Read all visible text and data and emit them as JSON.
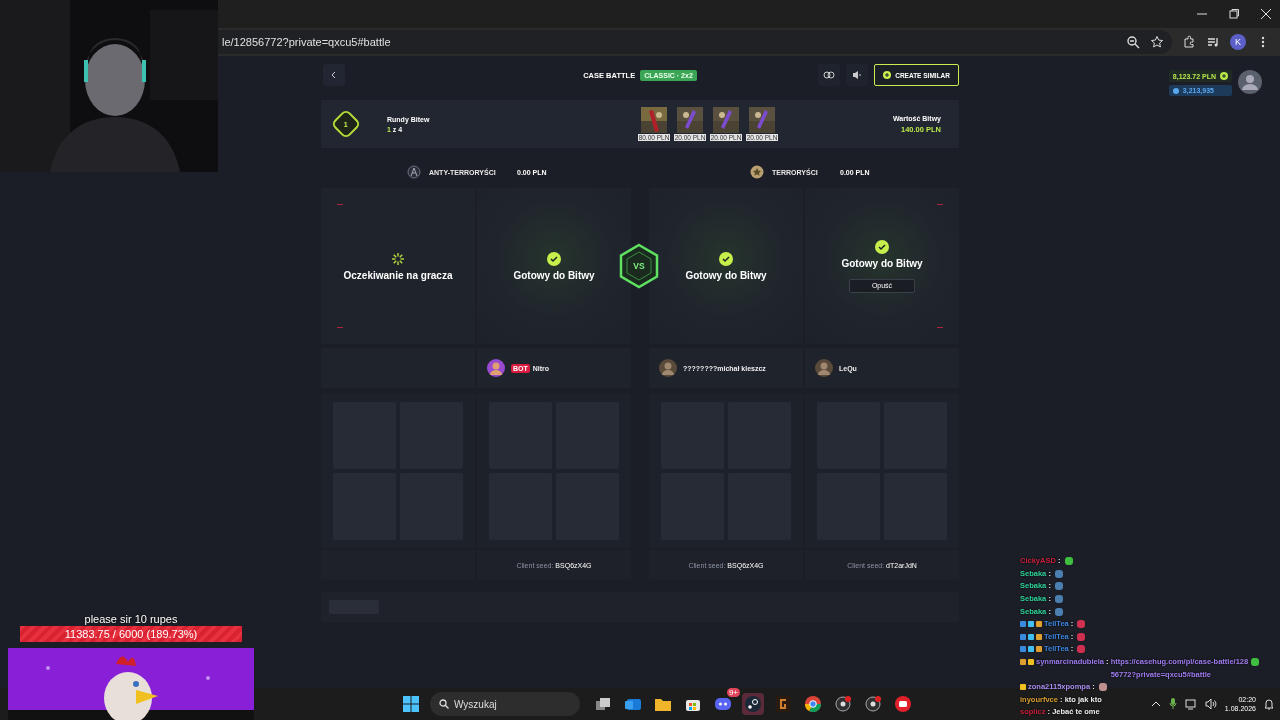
{
  "browser": {
    "url": "le/12856772?private=qxcu5#battle",
    "profile_initial": "K"
  },
  "header": {
    "title": "CASE BATTLE",
    "mode": "CLASSIC · 2x2",
    "create_button": "CREATE SIMILAR"
  },
  "balance": {
    "amount": "8,123.72 PLN",
    "points": "3,213,935"
  },
  "rounds": {
    "label": "Rundy Bitew",
    "badge": "1",
    "current": "1",
    "total": "z 4"
  },
  "cases": [
    {
      "price": "80.00 PLN",
      "kind": "gold"
    },
    {
      "price": "20.00 PLN",
      "kind": "purple"
    },
    {
      "price": "20.00 PLN",
      "kind": "purple"
    },
    {
      "price": "20.00 PLN",
      "kind": "purple"
    }
  ],
  "battle_value": {
    "label": "Wartość Bitwy",
    "amount": "140.00 PLN"
  },
  "teams": [
    {
      "name": "ANTY-TERRORYŚCI",
      "amount": "0.00 PLN",
      "kind": "ct"
    },
    {
      "name": "TERRORYŚCI",
      "amount": "0.00 PLN",
      "kind": "t"
    }
  ],
  "vs": "VS",
  "slots": [
    {
      "kind": "waiting",
      "status": "Oczekiwanie na gracza"
    },
    {
      "kind": "ready",
      "status": "Gotowy do Bitwy",
      "player": "Nitro",
      "bot_tag": "BOT",
      "seed_label": "Client seed:",
      "seed": "BSQ6zX4G"
    },
    {
      "kind": "ready",
      "status": "Gotowy do Bitwy",
      "player": "????????michał kleszcz",
      "seed_label": "Client seed:",
      "seed": "BSQ6zX4G"
    },
    {
      "kind": "ready",
      "status": "Gotowy do Bitwy",
      "player": "LeQu",
      "leave_button": "Opuść",
      "seed_label": "Client seed:",
      "seed": "dT2arJdN"
    }
  ],
  "donation": {
    "title": "please sir 10 rupes",
    "progress": "11383.75 / 6000 (189.73%)",
    "level": 1
  },
  "chat": [
    {
      "user": "CickyASD",
      "color": "#c8203c",
      "separator": ":",
      "emote": {
        "color": "#3fbf3f"
      }
    },
    {
      "user": "Sebaka",
      "color": "#2fd39a",
      "separator": ":",
      "emote": {
        "color": "#4a7fb0"
      }
    },
    {
      "user": "Sebaka",
      "color": "#2fd39a",
      "separator": ":",
      "emote": {
        "color": "#4a7fb0"
      }
    },
    {
      "user": "Sebaka",
      "color": "#2fd39a",
      "separator": ":",
      "emote": {
        "color": "#4a7fb0"
      }
    },
    {
      "user": "Sebaka",
      "color": "#2fd39a",
      "separator": ":",
      "emote": {
        "color": "#4a7fb0"
      }
    },
    {
      "user": "TellTea",
      "color": "#3d86e0",
      "separator": ":",
      "badges": [
        {
          "color": "#3a8ae0"
        },
        {
          "color": "#40c0f0"
        },
        {
          "color": "#e0a030"
        }
      ],
      "emote": {
        "color": "#d03050"
      }
    },
    {
      "user": "TellTea",
      "color": "#3d86e0",
      "separator": ":",
      "badges": [
        {
          "color": "#3a8ae0"
        },
        {
          "color": "#40c0f0"
        },
        {
          "color": "#e0a030"
        }
      ],
      "emote": {
        "color": "#d03050"
      }
    },
    {
      "user": "TellTea",
      "color": "#3d86e0",
      "separator": ":",
      "badges": [
        {
          "color": "#3a8ae0"
        },
        {
          "color": "#40c0f0"
        },
        {
          "color": "#e0a030"
        }
      ],
      "emote": {
        "color": "#d03050"
      }
    },
    {
      "user": "synmarcinadubiela",
      "color": "#9e7cf2",
      "separator": ":",
      "badges": [
        {
          "color": "#e0a030"
        },
        {
          "color": "#f0c020"
        }
      ],
      "link": "https://casehug.com/pl/case-battle/12856772?private=qxcu5#battle",
      "emote": {
        "color": "#3fbf3f"
      }
    },
    {
      "user": "zona2115xpompa",
      "color": "#a98ef0",
      "separator": ":",
      "badges": [
        {
          "color": "#f0c020"
        }
      ],
      "emote": {
        "color": "#c09090"
      }
    },
    {
      "user": "inyourfvce",
      "color": "#d9a030",
      "separator": ":",
      "text": "kto jak kto"
    },
    {
      "user": "soplicz",
      "color": "#c8203c",
      "separator": ":",
      "text": "Jebać te ome"
    }
  ],
  "taskbar": {
    "search_placeholder": "Wyszukaj",
    "notification_badge": "9+",
    "time": "02:20",
    "date": "1.08.2026"
  }
}
